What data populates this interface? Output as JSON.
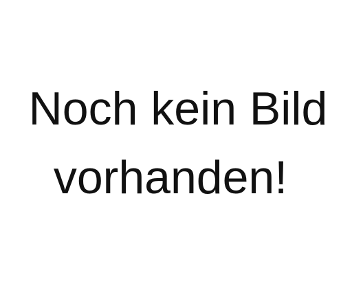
{
  "placeholder": {
    "line1": "Noch kein Bild",
    "line2": "vorhanden!"
  }
}
